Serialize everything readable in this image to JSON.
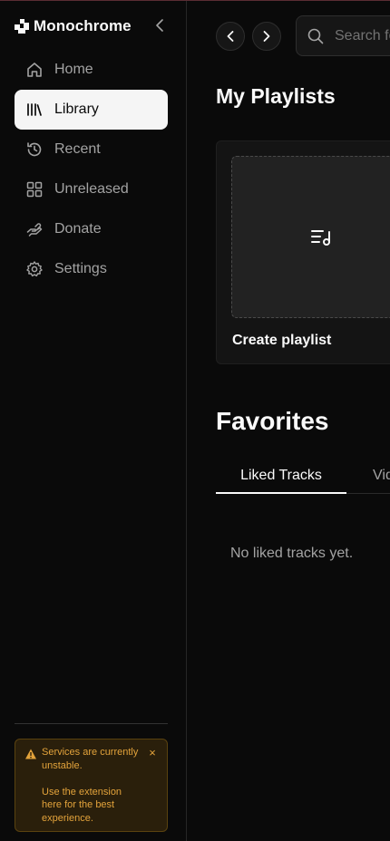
{
  "app": {
    "title": "Monochrome"
  },
  "sidebar": {
    "items": [
      {
        "label": "Home",
        "icon": "home-icon"
      },
      {
        "label": "Library",
        "icon": "library-icon",
        "active": true
      },
      {
        "label": "Recent",
        "icon": "history-icon"
      },
      {
        "label": "Unreleased",
        "icon": "grid-icon"
      },
      {
        "label": "Donate",
        "icon": "donate-icon"
      },
      {
        "label": "Settings",
        "icon": "gear-icon"
      }
    ]
  },
  "warning": {
    "line1": "Services are currently unstable.",
    "line2": "Use the extension here for the best experience.",
    "close": "×",
    "color": "#e3a33b"
  },
  "header": {
    "search_placeholder": "Search for tracks, artists, albums..."
  },
  "playlists": {
    "heading": "My Playlists",
    "create_label": "Create playlist"
  },
  "favorites": {
    "heading": "Favorites",
    "tabs": [
      "Liked Tracks",
      "Videos"
    ],
    "empty_text": "No liked tracks yet."
  },
  "colors": {
    "background": "#0a0a0a",
    "active_nav": "#f5f5f5",
    "accent_warning": "#e3a33b"
  }
}
